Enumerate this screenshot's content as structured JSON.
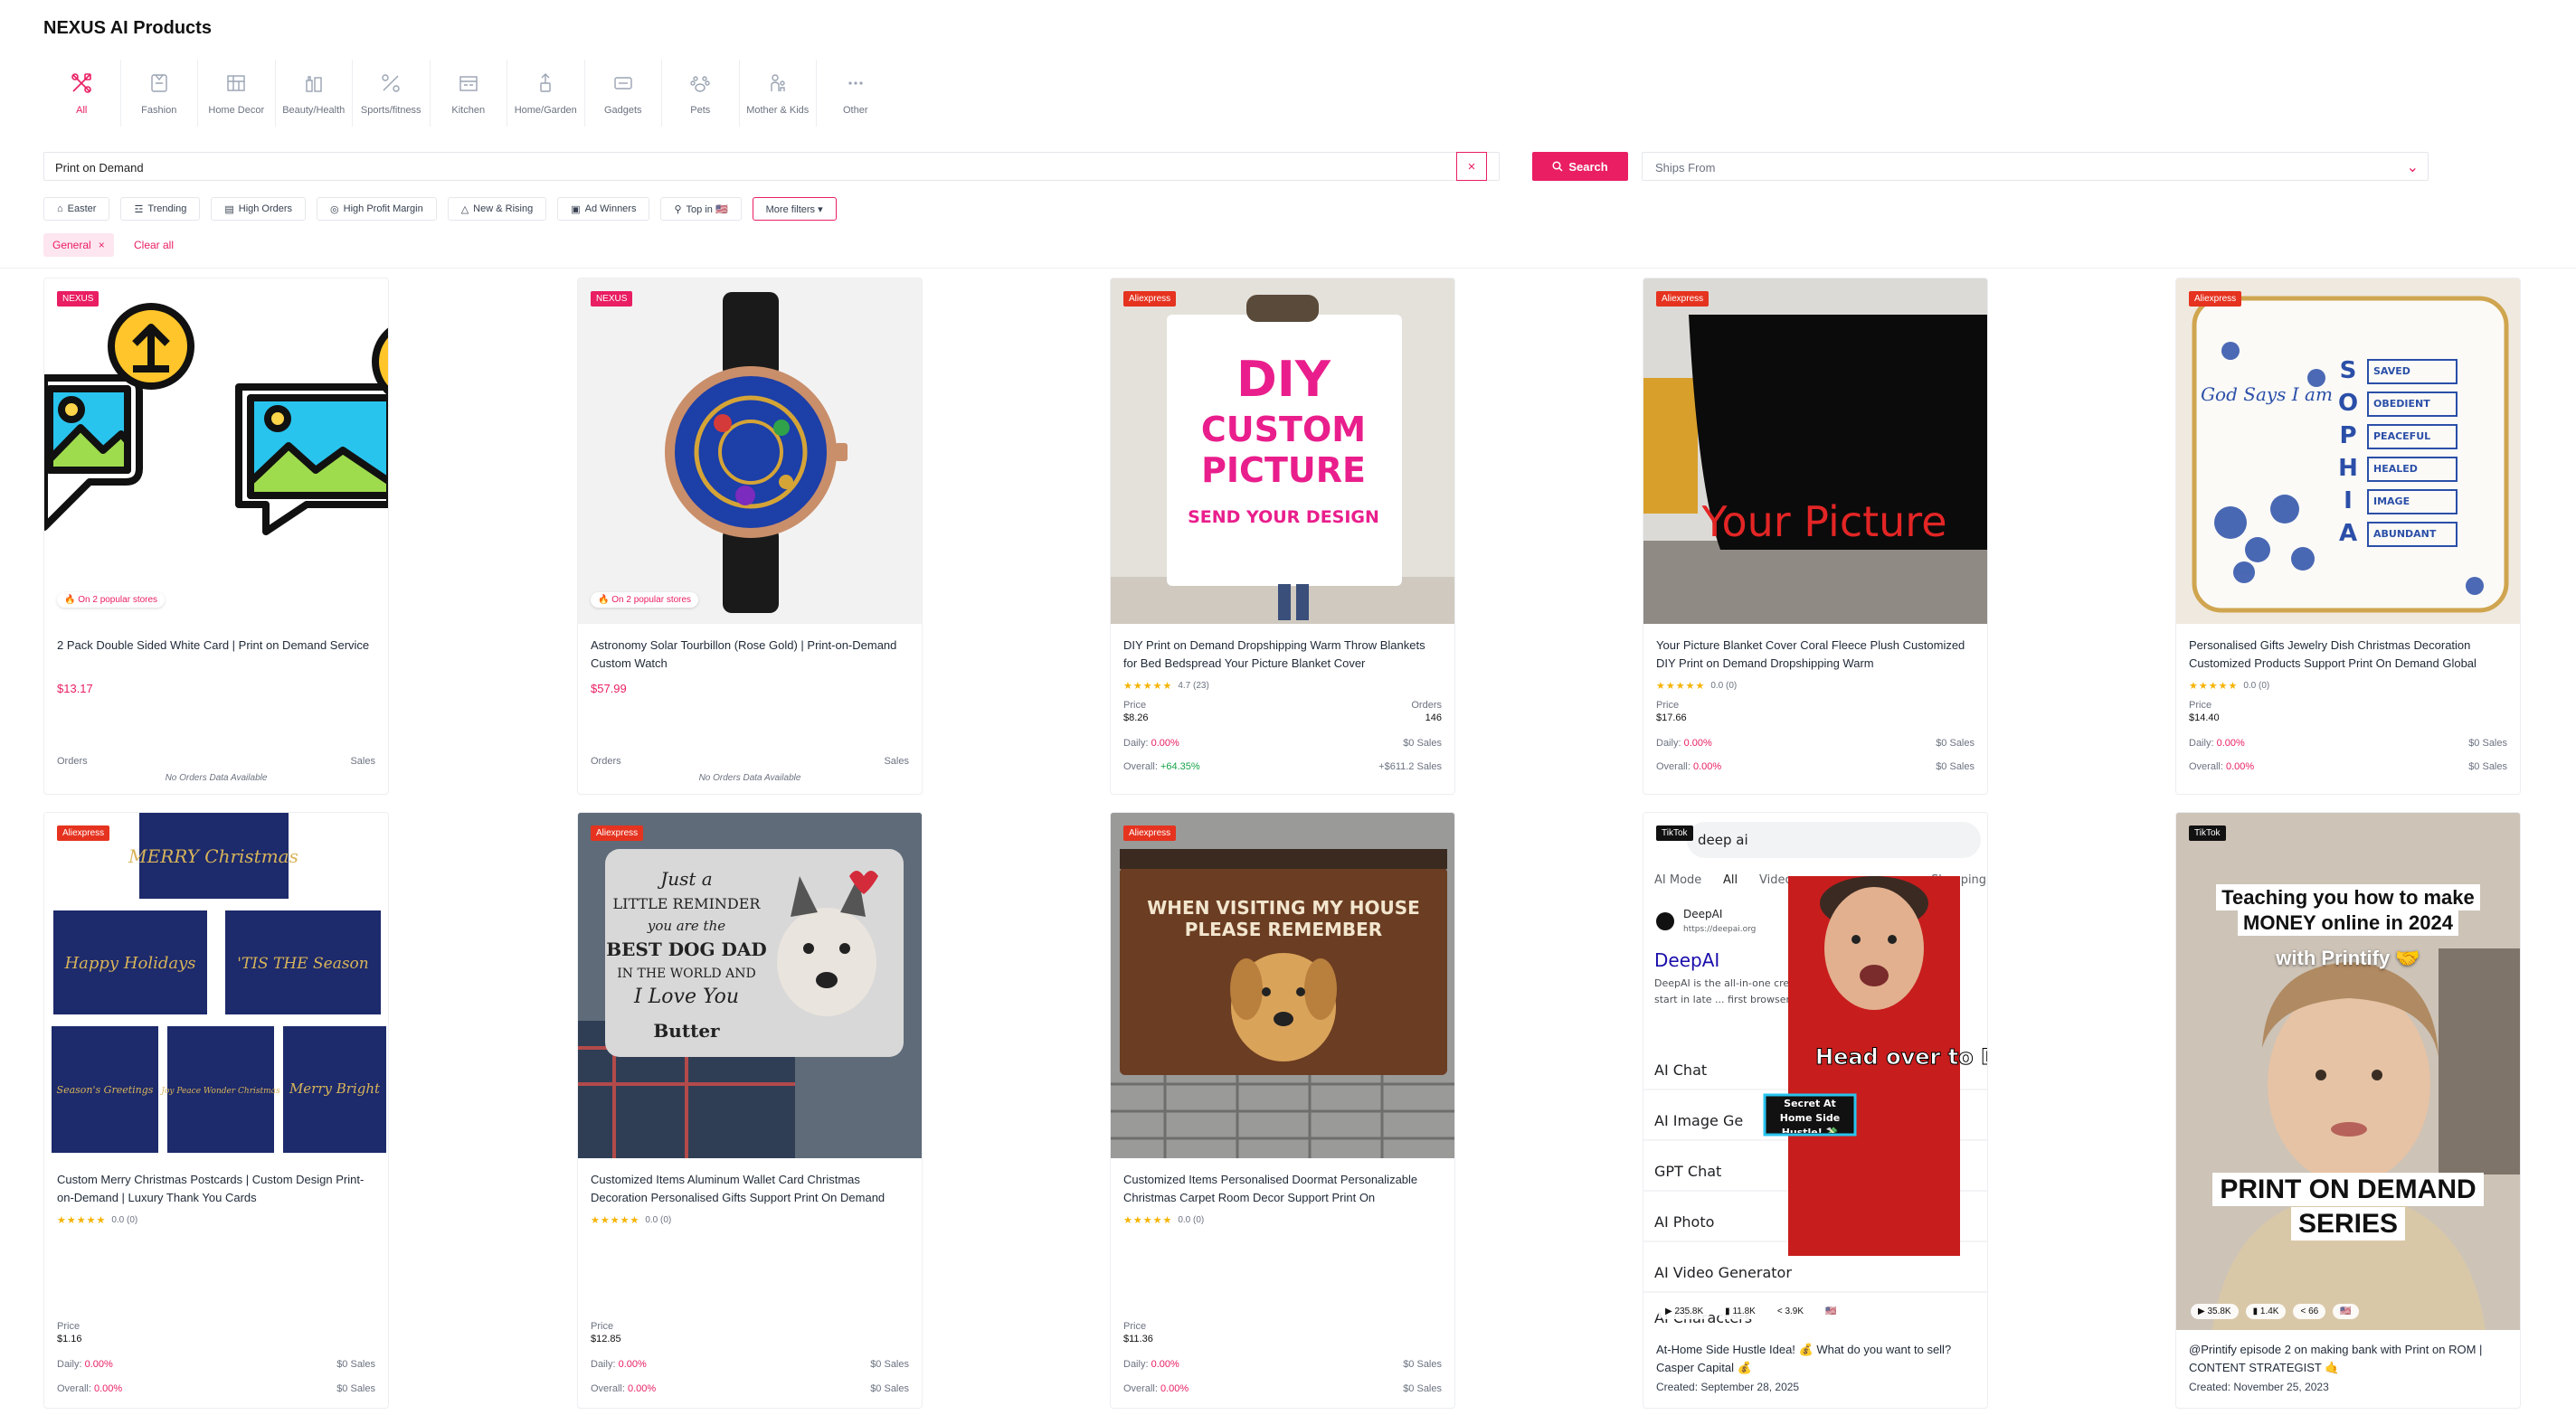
{
  "app": {
    "title": "NEXUS AI Products"
  },
  "categories": [
    {
      "label": "All",
      "icon": "all-icon",
      "active": true
    },
    {
      "label": "Fashion",
      "icon": "fashion-icon"
    },
    {
      "label": "Home Decor",
      "icon": "home-decor-icon"
    },
    {
      "label": "Beauty/Health",
      "icon": "beauty-icon"
    },
    {
      "label": "Sports/fitness",
      "icon": "sports-icon"
    },
    {
      "label": "Kitchen",
      "icon": "kitchen-icon"
    },
    {
      "label": "Home/Garden",
      "icon": "home-garden-icon"
    },
    {
      "label": "Gadgets",
      "icon": "gadgets-icon"
    },
    {
      "label": "Pets",
      "icon": "pets-icon"
    },
    {
      "label": "Mother & Kids",
      "icon": "mother-kids-icon"
    },
    {
      "label": "Other",
      "icon": "other-icon"
    }
  ],
  "search": {
    "value": "Print on Demand",
    "clear": "×",
    "button": "Search",
    "ships_placeholder": "Ships From",
    "ships_chevron": "⌄"
  },
  "chips": [
    {
      "label": "Easter",
      "icon": "easter-icon"
    },
    {
      "label": "Trending",
      "icon": "trending-icon"
    },
    {
      "label": "High Orders",
      "icon": "orders-icon"
    },
    {
      "label": "High Profit Margin",
      "icon": "profit-icon"
    },
    {
      "label": "New & Rising",
      "icon": "rising-icon"
    },
    {
      "label": "Ad Winners",
      "icon": "ad-icon"
    },
    {
      "label": "Top in 🇺🇸",
      "icon": "location-icon"
    },
    {
      "label": "More filters ▾",
      "icon": ""
    }
  ],
  "active_filter": {
    "label": "General",
    "x": "×",
    "clear_all": "Clear all"
  },
  "labels": {
    "orders": "Orders",
    "sales": "Sales",
    "price": "Price",
    "daily": "Daily:",
    "overall": "Overall:",
    "no_data": "No Orders Data Available",
    "popular": "🔥 On 2 popular stores",
    "stars": "★★★★★"
  },
  "products": [
    {
      "badge": "NEXUS",
      "title": "2 Pack Double Sided White Card | Print on Demand Service",
      "price": "$13.17"
    },
    {
      "badge": "NEXUS",
      "title": "Astronomy Solar Tourbillon (Rose Gold) | Print-on-Demand Custom Watch",
      "price": "$57.99"
    },
    {
      "badge": "Aliexpress",
      "title": "DIY Print on Demand Dropshipping Warm Throw Blankets for Bed Bedspread Your Picture Blanket Cover",
      "rating": "4.7 (23)",
      "price": "$8.26",
      "orders_label": "Orders",
      "orders": "146",
      "daily_pct": "0.00%",
      "daily_sales": "$0 Sales",
      "overall_pct": "+64.35%",
      "overall_sales": "+$611.2 Sales",
      "overall_positive": true
    },
    {
      "badge": "Aliexpress",
      "title": "Your Picture Blanket Cover Coral Fleece Plush Customized DIY Print on Demand Dropshipping Warm",
      "rating": "0.0 (0)",
      "price": "$17.66",
      "daily_pct": "0.00%",
      "daily_sales": "$0 Sales",
      "overall_pct": "0.00%",
      "overall_sales": "$0 Sales"
    },
    {
      "badge": "Aliexpress",
      "title": "Personalised Gifts Jewelry Dish Christmas Decoration Customized Products Support Print On Demand Global",
      "rating": "0.0 (0)",
      "price": "$14.40",
      "daily_pct": "0.00%",
      "daily_sales": "$0 Sales",
      "overall_pct": "0.00%",
      "overall_sales": "$0 Sales"
    },
    {
      "badge": "Aliexpress",
      "title": "Custom Merry Christmas Postcards | Custom Design Print-on-Demand | Luxury Thank You Cards",
      "rating": "0.0 (0)",
      "price": "$1.16",
      "daily_pct": "0.00%",
      "daily_sales": "$0 Sales",
      "overall_pct": "0.00%",
      "overall_sales": "$0 Sales"
    },
    {
      "badge": "Aliexpress",
      "title": "Customized Items Aluminum Wallet Card Christmas Decoration Personalised Gifts Support Print On Demand",
      "rating": "0.0 (0)",
      "price": "$12.85",
      "daily_pct": "0.00%",
      "daily_sales": "$0 Sales",
      "overall_pct": "0.00%",
      "overall_sales": "$0 Sales"
    },
    {
      "badge": "Aliexpress",
      "title": "Customized Items Personalised Doormat Personalizable Christmas Carpet Room Decor Support Print On",
      "rating": "0.0 (0)",
      "price": "$11.36",
      "daily_pct": "0.00%",
      "daily_sales": "$0 Sales",
      "overall_pct": "0.00%",
      "overall_sales": "$0 Sales"
    }
  ],
  "images": {
    "blanket_diy": {
      "l1": "DIY",
      "l2": "CUSTOM",
      "l3": "PICTURE",
      "l4": "SEND YOUR DESIGN"
    },
    "blanket_yours": {
      "text": "Your Picture"
    },
    "dish": {
      "left": "God Says I am",
      "letters": [
        "S",
        "O",
        "P",
        "H",
        "I",
        "A"
      ],
      "words": [
        "SAVED",
        "OBEDIENT",
        "PEACEFUL",
        "HEALED",
        "IMAGE",
        "ABUNDANT"
      ]
    },
    "postcards": {
      "top": "MERRY Christmas",
      "c2": "Happy Holidays",
      "c3": "'TIS THE Season",
      "c4": "Season's Greetings",
      "c5": "Joy Peace Wonder Christmas",
      "c6": "Merry Bright"
    },
    "wallet": {
      "l1": "Just a",
      "l2": "LITTLE REMINDER",
      "l3": "you are the",
      "l4": "BEST DOG DAD",
      "l5": "IN THE WORLD AND",
      "l6": "I Love You",
      "l7": "Butter"
    },
    "doormat": {
      "l1": "WHEN VISITING MY HOUSE",
      "l2": "PLEASE REMEMBER"
    }
  },
  "tiktok": [
    {
      "badge": "TikTok",
      "search_text": "deep ai",
      "tabs": [
        "AI Mode",
        "All",
        "Videos",
        "Shopping"
      ],
      "site_name": "DeepAI",
      "site_url": "https://deepai.org",
      "site_link": "DeepAI",
      "snippet": "DeepAI is the all-in-one creative AI for everyone. We got our start in late ... first browser-based text-to-image gen",
      "menu": [
        "AI Chat",
        "AI Image Ge",
        "GPT Chat",
        "AI Photo",
        "AI Video Generator",
        "AI Characters"
      ],
      "overlay": "Head over to Deep AI",
      "sticker": "Secret At Home Side Hustle! 💸",
      "stats": [
        "▶ 235.8K",
        "▮ 11.8K",
        "< 3.9K",
        "🇺🇸"
      ],
      "caption": "At-Home Side Hustle Idea! 💰 What do you want to sell? Casper Capital 💰",
      "created": "Created: September 28, 2025"
    },
    {
      "badge": "TikTok",
      "overlay_top": "Teaching you how to make MONEY online in 2024",
      "overlay_sub": "with Printify 🤝",
      "overlay_bottom": "PRINT ON DEMAND SERIES",
      "stats": [
        "▶ 35.8K",
        "▮ 1.4K",
        "< 66",
        "🇺🇸"
      ],
      "caption": "@Printify episode 2 on making bank with Print on ROM | CONTENT STRATEGIST 🤙",
      "created": "Created: November 25, 2023"
    }
  ],
  "colors": {
    "accent": "#e91e63",
    "aliexpress": "#e5331f",
    "positive": "#16a34a"
  }
}
